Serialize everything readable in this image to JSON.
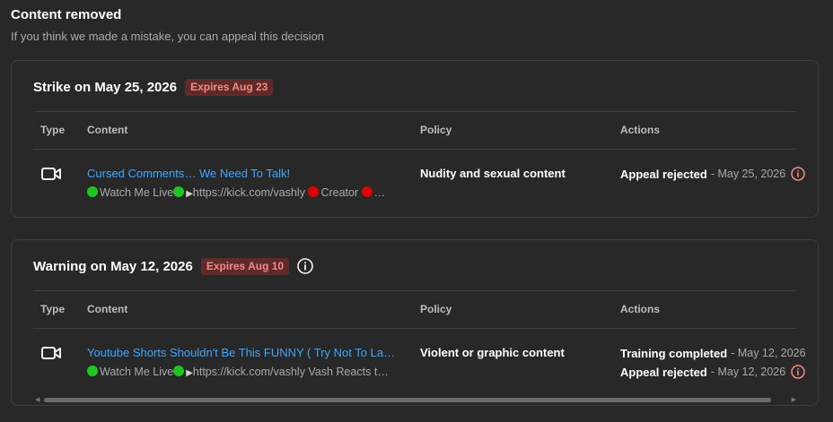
{
  "header": {
    "title": "Content removed",
    "subtitle": "If you think we made a mistake, you can appeal this decision"
  },
  "colors": {
    "link": "#3ea6ff",
    "badge_bg": "#5e2a2a",
    "badge_text": "#f28b82",
    "alert": "#f28b82"
  },
  "cards": [
    {
      "title": "Strike on May 25, 2026",
      "badge": "Expires Aug 23",
      "columns": {
        "type": "Type",
        "content": "Content",
        "policy": "Policy",
        "actions": "Actions"
      },
      "row": {
        "type_icon": "video-camera-icon",
        "video_title": "Cursed Comments… We Need To Talk!",
        "description": "Watch Me Live",
        "desc_link": "https://kick.com/vashly",
        "desc_tail": "Creator",
        "desc_more": "…",
        "policy": "Nudity and sexual content",
        "actions": [
          {
            "status": "Appeal rejected",
            "date": "- May 25, 2026"
          }
        ]
      }
    },
    {
      "title": "Warning on May 12, 2026",
      "badge": "Expires Aug 10",
      "columns": {
        "type": "Type",
        "content": "Content",
        "policy": "Policy",
        "actions": "Actions"
      },
      "row": {
        "type_icon": "video-camera-icon",
        "video_title": "Youtube Shorts Shouldn't Be This FUNNY ( Try Not To Laugh )",
        "description": "Watch Me Live",
        "desc_link": "https://kick.com/vashly Vash Reacts to Funny Videos",
        "policy": "Violent or graphic content",
        "actions": [
          {
            "status": "Training completed",
            "date": "- May 12, 2026"
          },
          {
            "status": "Appeal rejected",
            "date": "- May 12, 2026"
          }
        ]
      }
    }
  ]
}
